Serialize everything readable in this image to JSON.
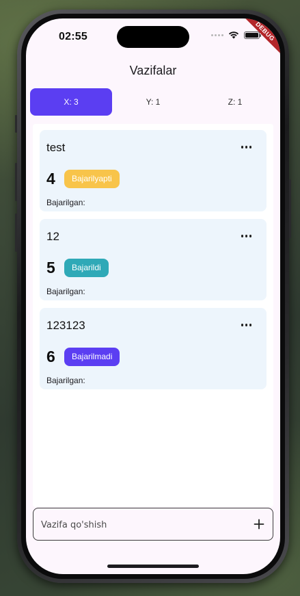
{
  "status_bar": {
    "time": "02:55",
    "debug_label": "DEBUG"
  },
  "app": {
    "title": "Vazifalar"
  },
  "tabs": [
    {
      "label": "X: 3",
      "active": true
    },
    {
      "label": "Y: 1",
      "active": false
    },
    {
      "label": "Z: 1",
      "active": false
    }
  ],
  "tasks": [
    {
      "title": "test",
      "number": "4",
      "status": "Bajarilyapti",
      "status_color": "#f8c44a",
      "done_label": "Bajarilgan:"
    },
    {
      "title": "12",
      "number": "5",
      "status": "Bajarildi",
      "status_color": "#2fa9b7",
      "done_label": "Bajarilgan:"
    },
    {
      "title": "123123",
      "number": "6",
      "status": "Bajarilmadi",
      "status_color": "#5b3ef2",
      "done_label": "Bajarilgan:"
    }
  ],
  "input": {
    "placeholder": "Vazifa qo'shish",
    "value": ""
  },
  "colors": {
    "accent": "#5b3ef2",
    "card_bg": "#edf5fc",
    "screen_bg": "#fdf6fd"
  },
  "icons": {
    "more": "more-horizontal-icon",
    "add": "plus-icon",
    "wifi": "wifi-icon",
    "battery": "battery-icon"
  }
}
